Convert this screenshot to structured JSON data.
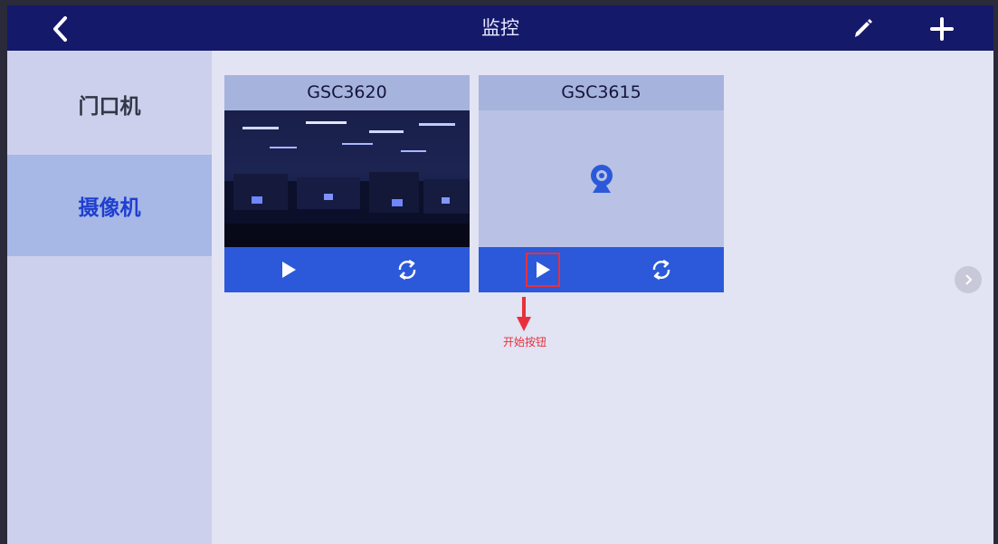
{
  "header": {
    "title": "监控",
    "back_icon": "chevron-left-icon",
    "edit_icon": "pencil-icon",
    "add_icon": "plus-icon"
  },
  "sidebar": {
    "items": [
      {
        "label": "门口机",
        "active": false
      },
      {
        "label": "摄像机",
        "active": true
      }
    ]
  },
  "cameras": [
    {
      "name": "GSC3620",
      "has_video": true,
      "play_icon": "play-icon",
      "refresh_icon": "refresh-icon"
    },
    {
      "name": "GSC3615",
      "has_video": false,
      "placeholder_icon": "webcam-icon",
      "play_icon": "play-icon",
      "refresh_icon": "refresh-icon"
    }
  ],
  "pager": {
    "next_icon": "chevron-right-icon"
  },
  "annotation": {
    "label": "开始按钮",
    "icon": "arrow-down-icon"
  },
  "colors": {
    "header_bg": "#14196a",
    "controls_bg": "#2b59da",
    "active_text": "#1f3fd0",
    "annotation": "#e8303b"
  }
}
